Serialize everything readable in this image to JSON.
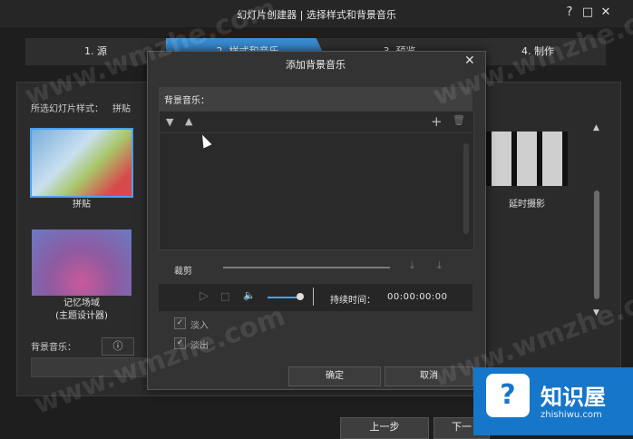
{
  "window": {
    "title": "幻灯片创建器 | 选择样式和背景音乐",
    "help": "?",
    "maximize": "□",
    "close": "✕"
  },
  "steps": [
    "1. 源",
    "2. 样式和音乐",
    "3. 预览",
    "4. 制作"
  ],
  "main": {
    "style_label": "所选幻灯片样式：",
    "style_value": "拼贴",
    "thumbs": [
      {
        "caption": "拼贴"
      },
      {
        "caption": "记忆场域"
      },
      {
        "caption2": "(主题设计器)"
      },
      {
        "caption": "延时摄影"
      }
    ],
    "bgm_label": "背景音乐：",
    "bgm_info": "ⓘ",
    "prev": "上一步",
    "next": "下一"
  },
  "dialog": {
    "title": "添加背景音乐",
    "close": "✕",
    "header": "背景音乐：",
    "tool_down": "▼",
    "tool_up": "▲",
    "tool_add": "+",
    "tool_delete": "🗑",
    "trim_label": "裁剪",
    "duration_label": "持续时间：",
    "duration_value": "00:00:00:00",
    "fade_in": "淡入",
    "fade_out": "淡出",
    "ok": "确定",
    "cancel": "取消",
    "play": "▷",
    "stop": "□",
    "volume": "🔈"
  },
  "watermark": "www.wmzhe.com",
  "badge": {
    "title": "知识屋",
    "sub": "zhishiwu.com",
    "icon": "?"
  }
}
